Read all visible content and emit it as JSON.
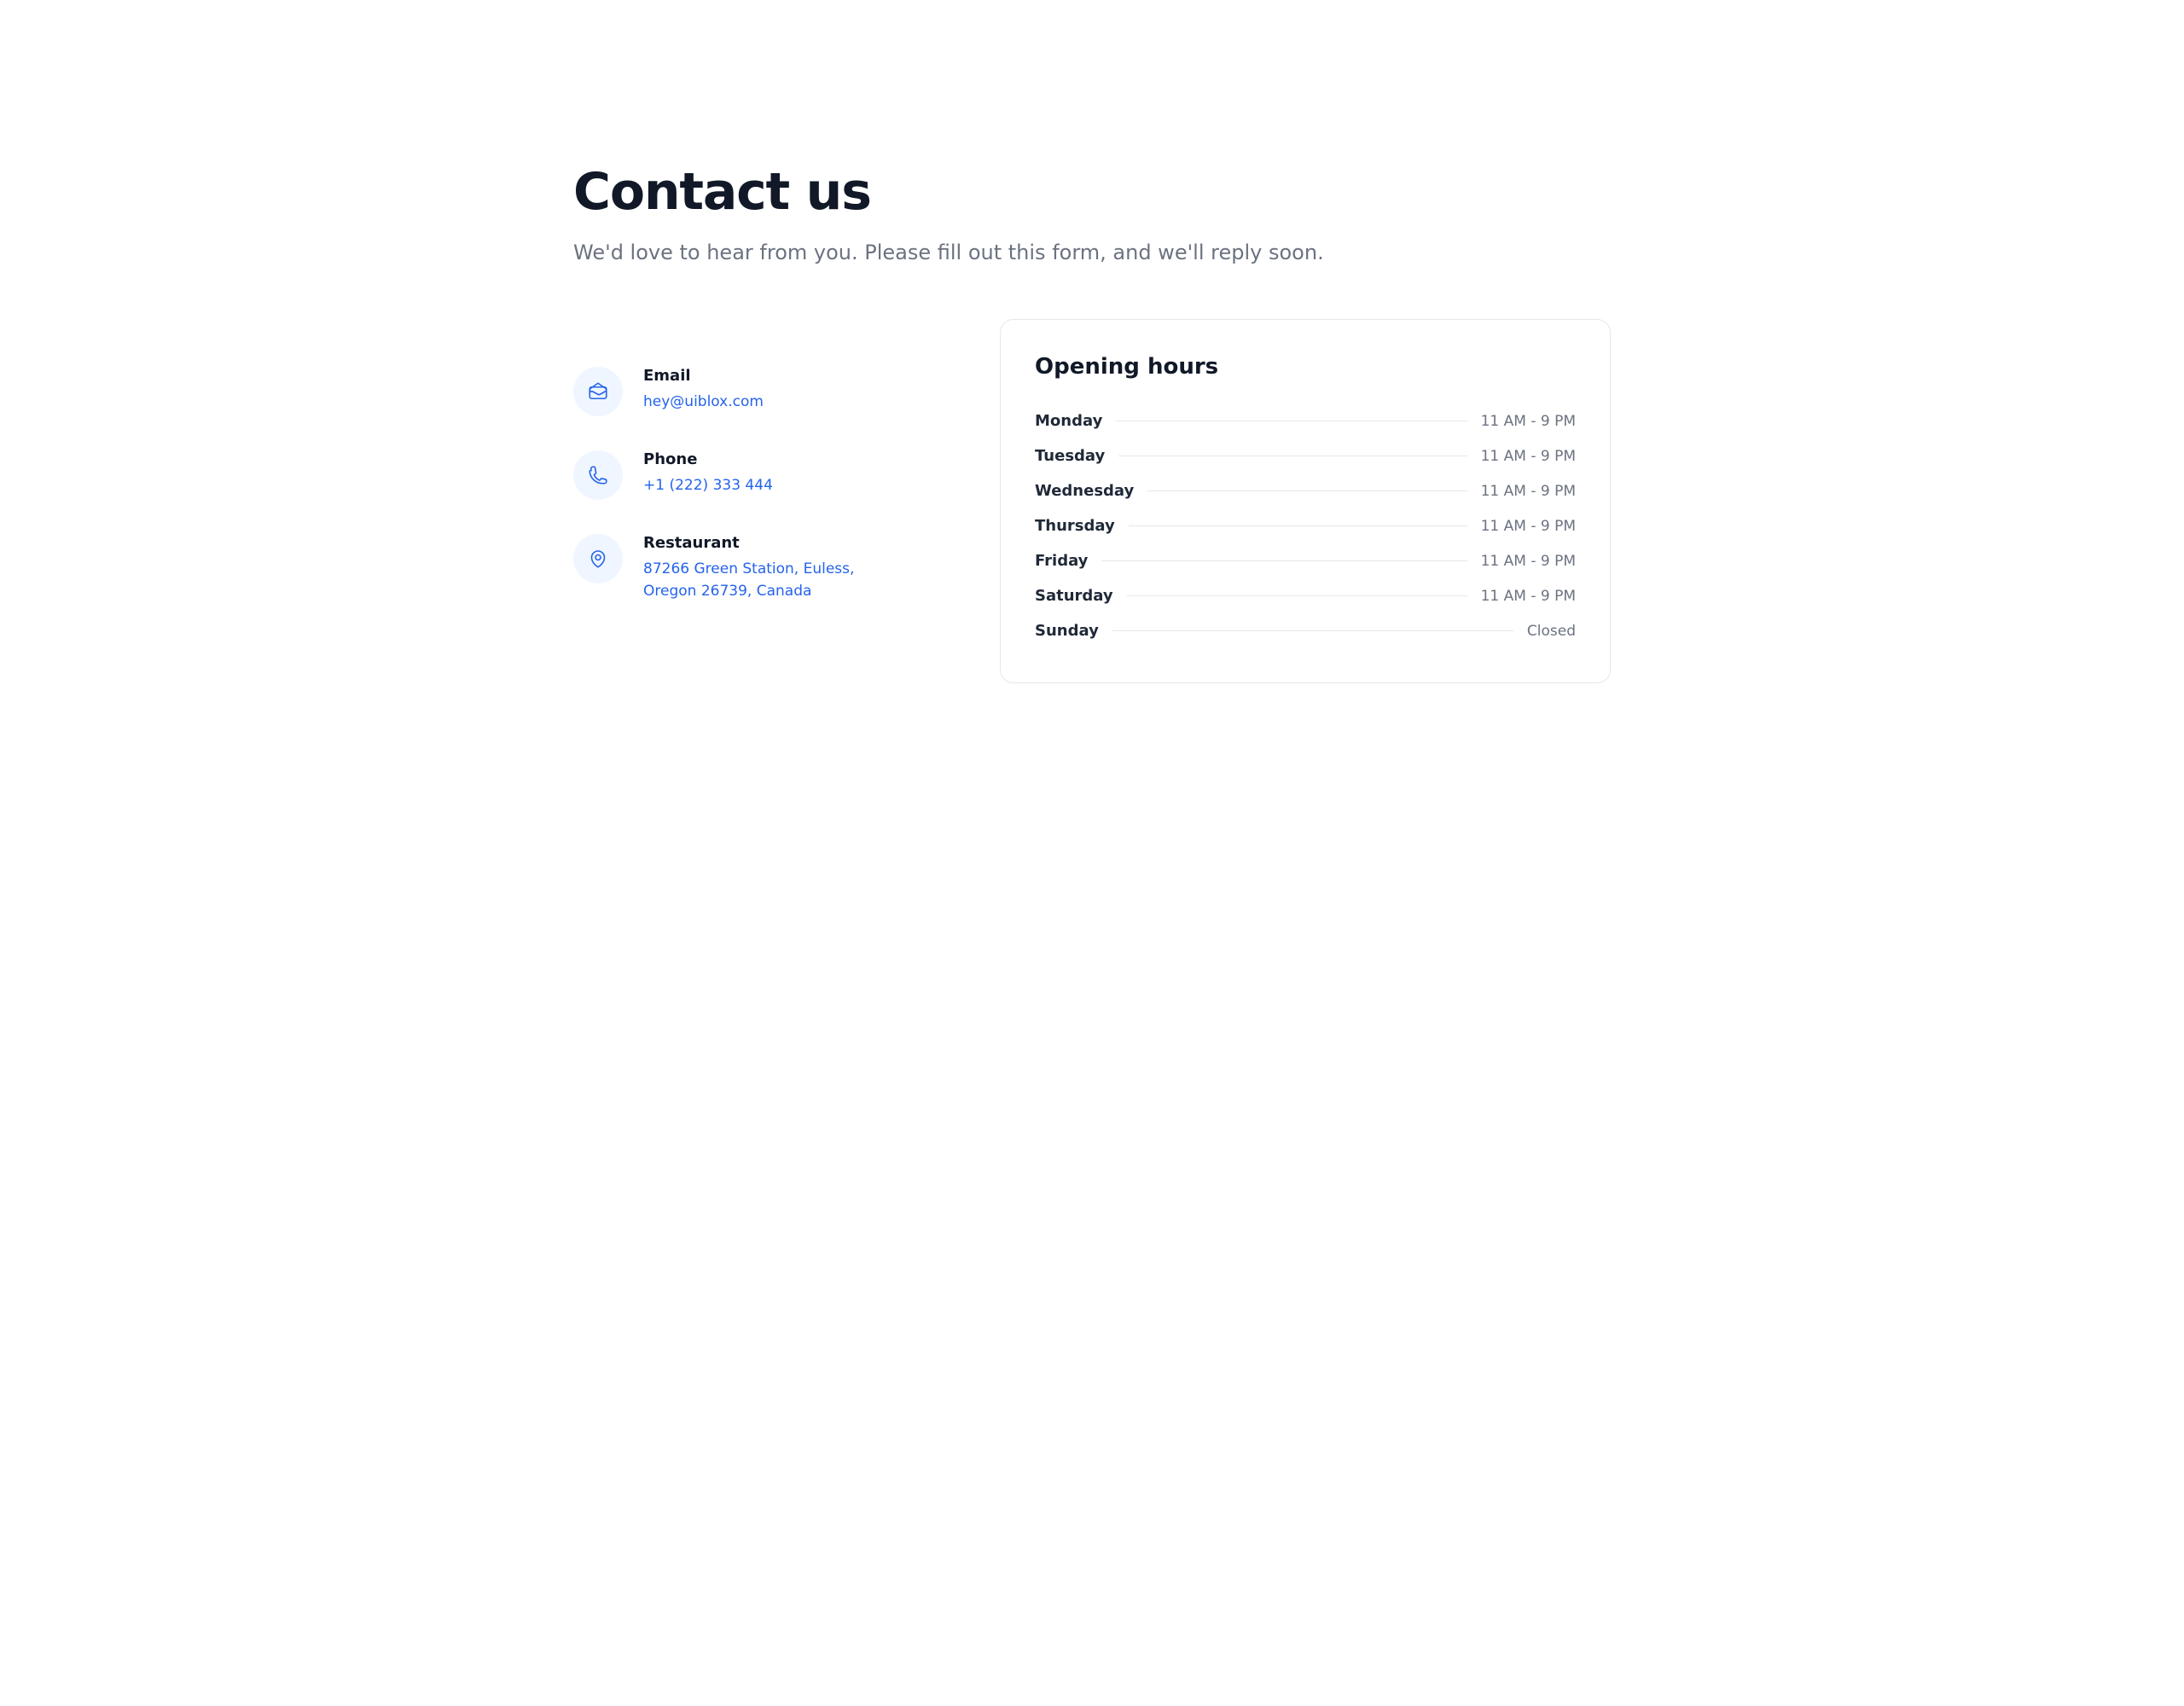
{
  "header": {
    "title": "Contact us",
    "subtitle": "We'd love to hear from you. Please fill out this form, and we'll reply soon."
  },
  "contacts": {
    "email": {
      "label": "Email",
      "value": "hey@uiblox.com"
    },
    "phone": {
      "label": "Phone",
      "value": "+1 (222) 333 444"
    },
    "address": {
      "label": "Restaurant",
      "value": "87266 Green Station, Euless, Oregon 26739, Canada"
    }
  },
  "hours": {
    "title": "Opening hours",
    "rows": [
      {
        "day": "Monday",
        "time": "11 AM - 9 PM"
      },
      {
        "day": "Tuesday",
        "time": "11 AM - 9 PM"
      },
      {
        "day": "Wednesday",
        "time": "11 AM - 9 PM"
      },
      {
        "day": "Thursday",
        "time": "11 AM - 9 PM"
      },
      {
        "day": "Friday",
        "time": "11 AM - 9 PM"
      },
      {
        "day": "Saturday",
        "time": "11 AM - 9 PM"
      },
      {
        "day": "Sunday",
        "time": "Closed"
      }
    ]
  }
}
